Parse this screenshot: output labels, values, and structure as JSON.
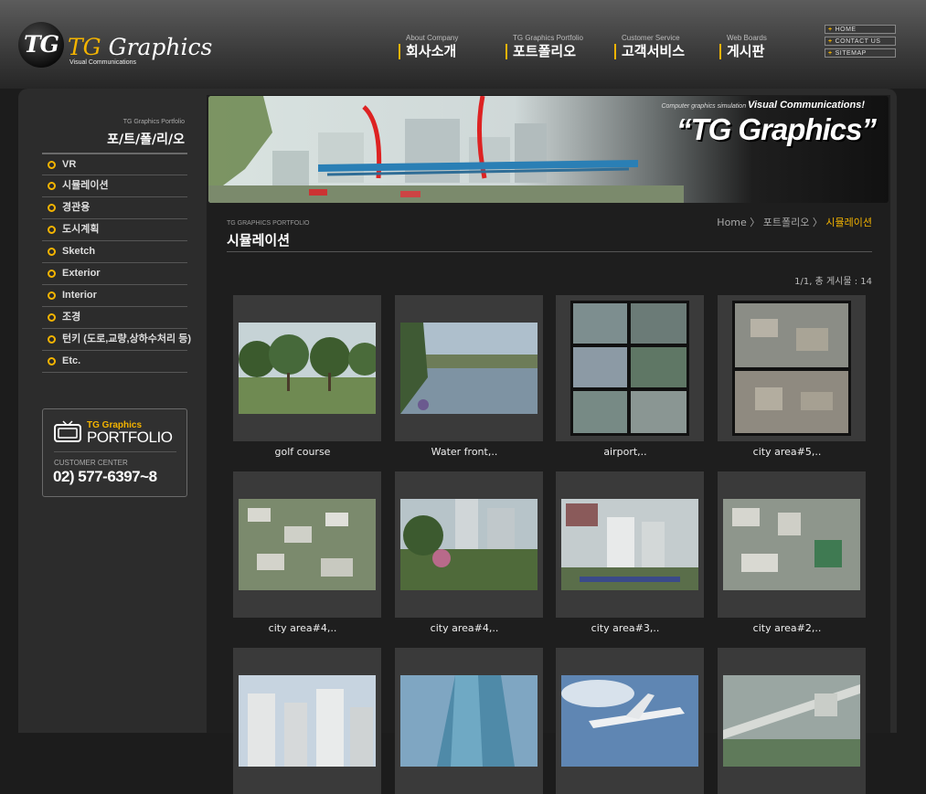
{
  "brand": {
    "logo_mark": "TG",
    "logo_first": "TG",
    "logo_second": " Graphics",
    "logo_sub": "Visual Communications"
  },
  "global_nav": [
    {
      "en": "About Company",
      "ko": "회사소개"
    },
    {
      "en": "TG Graphics Portfolio",
      "ko": "포트폴리오"
    },
    {
      "en": "Customer Service",
      "ko": "고객서비스"
    },
    {
      "en": "Web Boards",
      "ko": "게시판"
    }
  ],
  "util_links": [
    "HOME",
    "CONTACT US",
    "SITEMAP"
  ],
  "sidebar": {
    "title_en": "TG Graphics Portfolio",
    "title": "포/트/폴/리/오",
    "items": [
      "VR",
      "시뮬레이션",
      "경관용",
      "도시계획",
      "Sketch",
      "Exterior",
      "Interior",
      "조경",
      "턴키 (도로,교량,상하수처리 등)",
      "Etc."
    ]
  },
  "center_box": {
    "brand": "TG Graphics",
    "portfolio": "PORTFOLIO",
    "label": "CUSTOMER CENTER",
    "phone": "02) 577-6397~8"
  },
  "banner": {
    "tag_prefix": "Computer graphics simulation",
    "tag": "Visual Communications!",
    "title": "“TG Graphics”"
  },
  "breadcrumb": {
    "home": "Home",
    "sep1": " 〉 ",
    "parent": "포트폴리오",
    "sep2": " 〉 ",
    "current": "시뮬레이션"
  },
  "page": {
    "title_en": "TG GRAPHICS PORTFOLIO",
    "title": "시뮬레이션"
  },
  "count_text": "1/1, 총 게시물 : 14",
  "gallery": [
    {
      "caption": "golf course",
      "thumb": "golf-course-thumbnail"
    },
    {
      "caption": "Water front,..",
      "thumb": "water-front-thumbnail"
    },
    {
      "caption": "airport,..",
      "thumb": "airport-thumbnail"
    },
    {
      "caption": "city area#5,..",
      "thumb": "city-area-5-thumbnail"
    },
    {
      "caption": "city area#4,..",
      "thumb": "city-area-4-thumbnail"
    },
    {
      "caption": "city area#4,..",
      "thumb": "city-area-4-thumbnail"
    },
    {
      "caption": "city area#3,..",
      "thumb": "city-area-3-thumbnail"
    },
    {
      "caption": "city area#2,..",
      "thumb": "city-area-2-thumbnail"
    },
    {
      "caption": "",
      "thumb": "city-buildings-thumbnail"
    },
    {
      "caption": "",
      "thumb": "tower-thumbnail"
    },
    {
      "caption": "",
      "thumb": "airplane-thumbnail"
    },
    {
      "caption": "",
      "thumb": "bridge-thumbnail"
    }
  ],
  "colors": {
    "accent": "#f4b400",
    "panel": "#2c2c2c",
    "card": "#3a3a3a"
  }
}
